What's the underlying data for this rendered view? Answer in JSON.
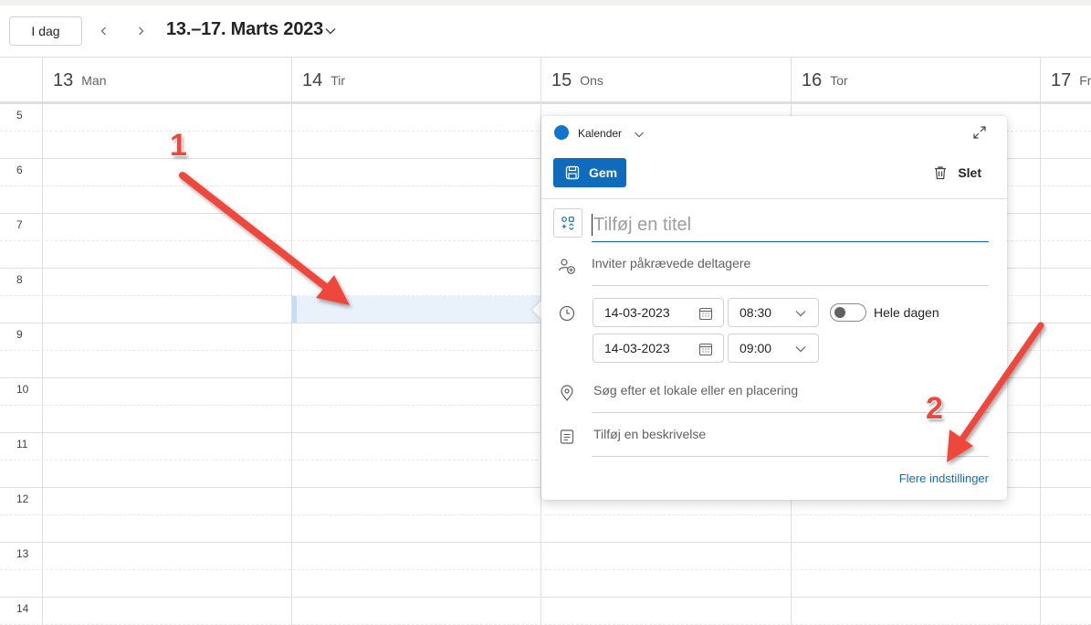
{
  "toolbar": {
    "today_label": "I dag",
    "prev_icon": "chevron-left-icon",
    "next_icon": "chevron-right-icon",
    "range_title": "13.–17. Marts 2023"
  },
  "days": [
    {
      "num": "13",
      "name": "Man"
    },
    {
      "num": "14",
      "name": "Tir"
    },
    {
      "num": "15",
      "name": "Ons"
    },
    {
      "num": "16",
      "name": "Tor"
    },
    {
      "num": "17",
      "name": "Fre"
    }
  ],
  "hours": [
    "5",
    "6",
    "7",
    "8",
    "9",
    "10",
    "11",
    "12",
    "13",
    "14"
  ],
  "popup": {
    "calendar_name": "Kalender",
    "calendar_color": "#1373d1",
    "save_label": "Gem",
    "delete_label": "Slet",
    "title_placeholder": "Tilføj en titel",
    "attendees_placeholder": "Inviter påkrævede deltagere",
    "start_date": "14-03-2023",
    "start_time": "08:30",
    "end_date": "14-03-2023",
    "end_time": "09:00",
    "allday_label": "Hele dagen",
    "location_placeholder": "Søg efter et lokale eller en placering",
    "description_placeholder": "Tilføj en beskrivelse",
    "more_options_label": "Flere indstillinger"
  },
  "annotations": {
    "marker_1": "1",
    "marker_2": "2",
    "arrow_color": "#f0463c"
  },
  "colors": {
    "accent": "#0f6cbd",
    "selection": "#e9f1fb"
  }
}
